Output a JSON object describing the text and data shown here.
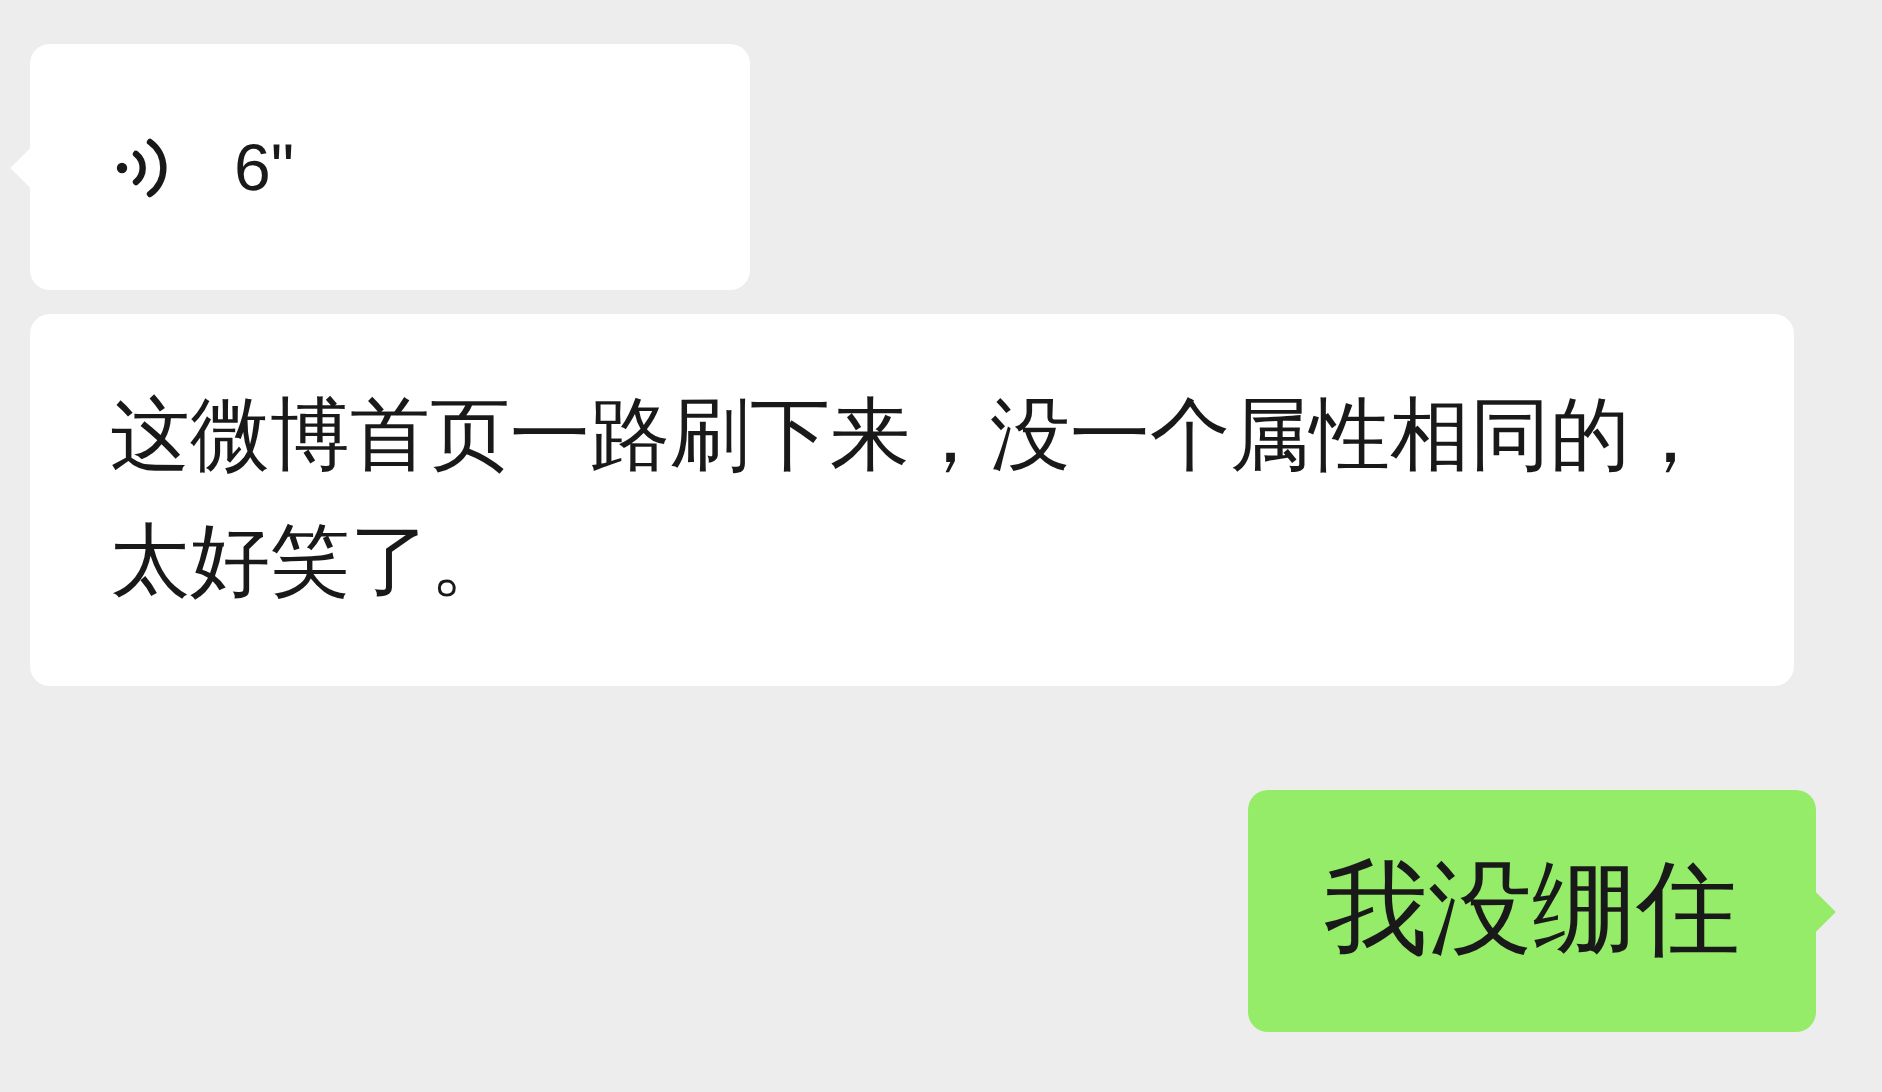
{
  "messages": [
    {
      "kind": "voice",
      "outgoing": false,
      "duration": "6\""
    },
    {
      "kind": "text",
      "outgoing": false,
      "text": "这微博首页一路刷下来，没一个属性相同的，太好笑了。"
    },
    {
      "kind": "text",
      "outgoing": true,
      "text": "我没绷住"
    }
  ]
}
